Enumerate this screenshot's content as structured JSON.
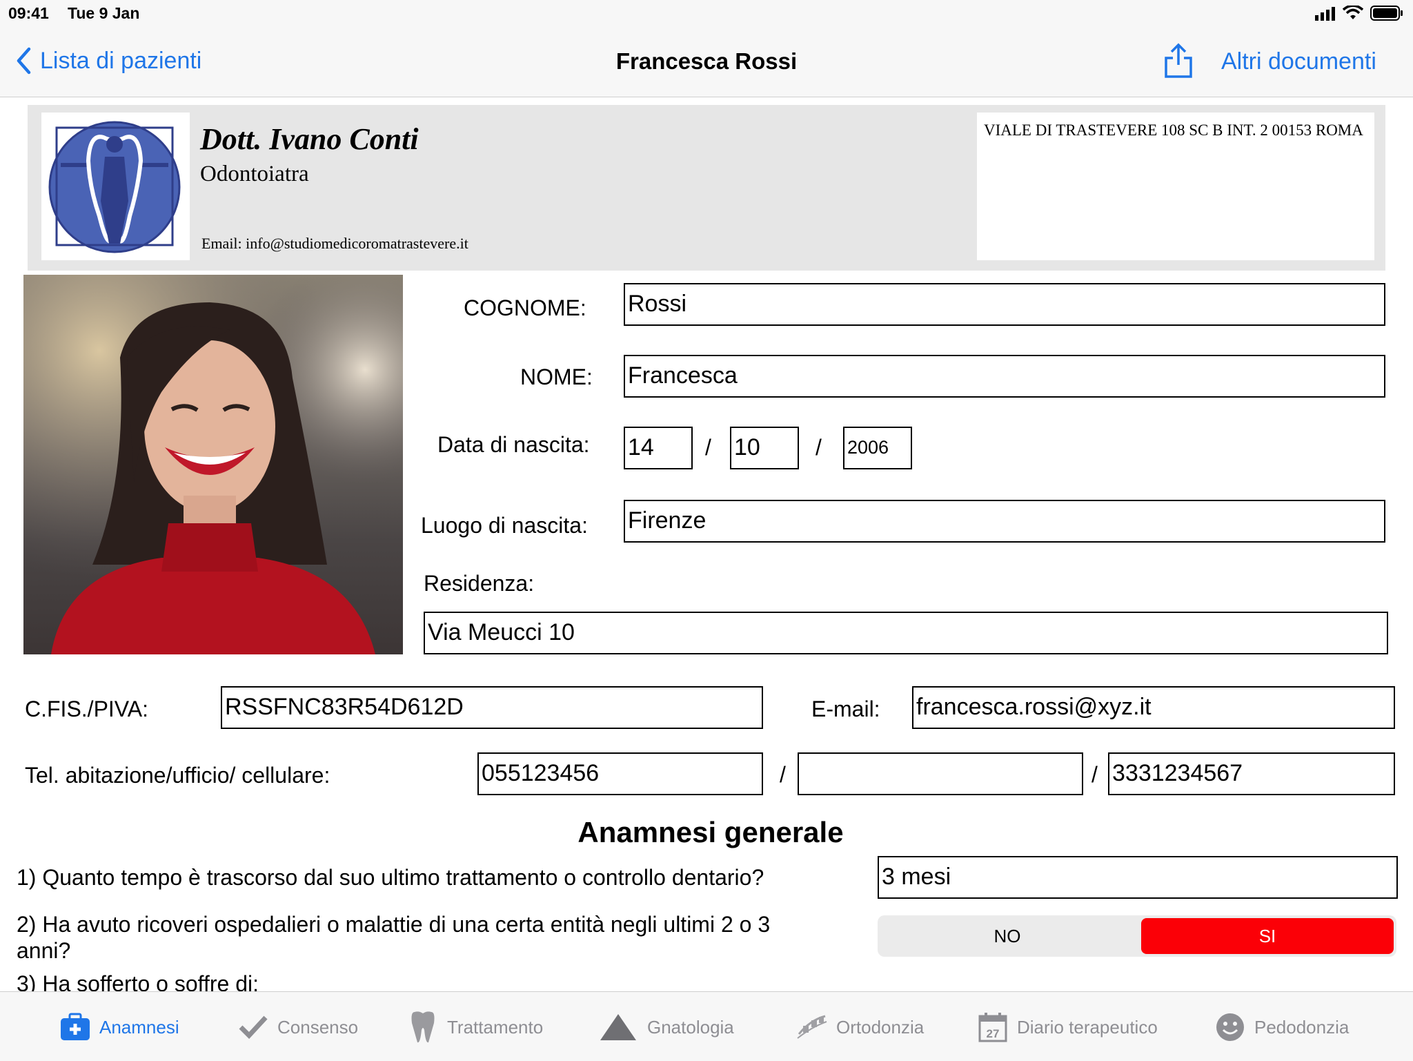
{
  "status": {
    "time": "09:41",
    "date": "Tue 9 Jan"
  },
  "nav": {
    "back_label": "Lista di pazienti",
    "title": "Francesca Rossi",
    "more_docs_label": "Altri documenti"
  },
  "letterhead": {
    "doctor_name": "Dott. Ivano Conti",
    "specialty": "Odontoiatra",
    "email": "Email: info@studiomedicoromatrastevere.it",
    "address": "VIALE DI TRASTEVERE 108 SC B INT. 2 00153 ROMA"
  },
  "form": {
    "cognome_label": "COGNOME:",
    "cognome_value": "Rossi",
    "nome_label": "NOME:",
    "nome_value": "Francesca",
    "dob_label": "Data di nascita:",
    "dob_day": "14",
    "dob_month": "10",
    "dob_year": "2006",
    "dob_sep": "/",
    "luogo_label": "Luogo di nascita:",
    "luogo_value": "Firenze",
    "residenza_label": "Residenza:",
    "residenza_value": "Via Meucci 10",
    "cf_label": "C.FIS./PIVA:",
    "cf_value": "RSSFNC83R54D612D",
    "email_label": "E-mail:",
    "email_value": "francesca.rossi@xyz.it",
    "tel_label": "Tel. abitazione/ufficio/ cellulare:",
    "tel_home": "055123456",
    "tel_office": "",
    "tel_mobile": "3331234567",
    "tel_sep": "/"
  },
  "anamnesi": {
    "heading": "Anamnesi generale",
    "q1": "1) Quanto tempo è trascorso dal suo ultimo trattamento o controllo dentario?",
    "q1_answer": "3 mesi",
    "q2": "2) Ha avuto ricoveri ospedalieri o malattie di una certa entità negli ultimi 2 o 3 anni?",
    "q2_no": "NO",
    "q2_si": "SI",
    "q2_selected": "SI",
    "q3": "3) Ha sofferto o soffre di:"
  },
  "tabs": [
    {
      "label": "Anamnesi",
      "icon": "medkit-icon",
      "active": true
    },
    {
      "label": "Consenso",
      "icon": "checkmark-icon"
    },
    {
      "label": "Trattamento",
      "icon": "tooth-icon"
    },
    {
      "label": "Gnatologia",
      "icon": "triangle-icon"
    },
    {
      "label": "Ortodonzia",
      "icon": "braces-icon"
    },
    {
      "label": "Diario terapeutico",
      "icon": "calendar-icon",
      "calendar_day": "27"
    },
    {
      "label": "Pedodonzia",
      "icon": "smiley-icon"
    }
  ],
  "colors": {
    "accent": "#1f76e8",
    "selected_red": "#fb0007",
    "logo_blue": "#4a63b5"
  }
}
